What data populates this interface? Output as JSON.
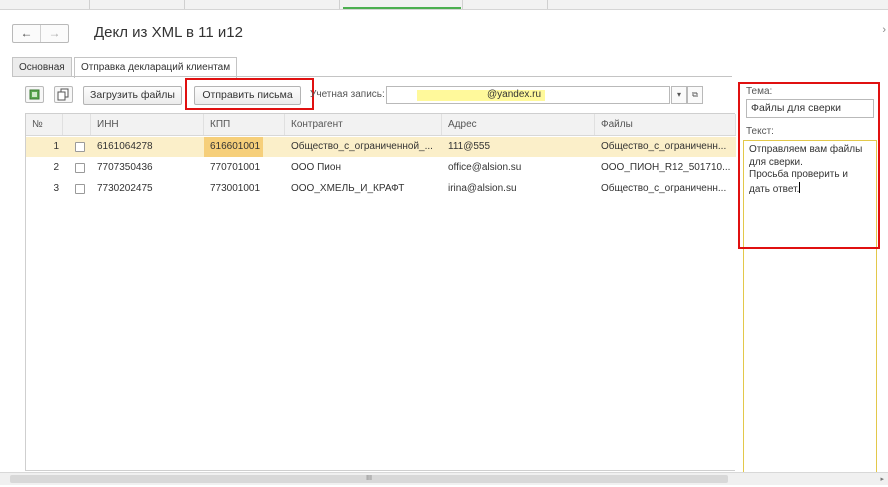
{
  "window": {
    "title": "Декл из XML в 11 и12",
    "close_icon": "close-icon"
  },
  "nav": {
    "back_icon": "←",
    "forward_icon": "→"
  },
  "tabs": [
    {
      "label": "Основная",
      "active": false
    },
    {
      "label": "Отправка деклараций клиентам",
      "active": true
    }
  ],
  "toolbar": {
    "load_files_label": "Загрузить файлы",
    "send_letters_label": "Отправить письма",
    "account_label": "Учетная запись:",
    "account_value": "@yandex.ru",
    "account_dropdown_glyph": "▾",
    "account_open_glyph": "⧉"
  },
  "table": {
    "columns": [
      "№",
      "",
      "ИНН",
      "КПП",
      "Контрагент",
      "Адрес",
      "Файлы"
    ],
    "rows": [
      {
        "num": "1",
        "checked": false,
        "inn": "6161064278",
        "kpp": "616601001",
        "contragent": "Общество_с_ограниченной_...",
        "address": "111@555",
        "files": "Общество_с_ограниченн..."
      },
      {
        "num": "2",
        "checked": false,
        "inn": "7707350436",
        "kpp": "770701001",
        "contragent": "ООО Пион",
        "address": "office@alsion.su",
        "files": "ООО_ПИОН_R12_501710..."
      },
      {
        "num": "3",
        "checked": false,
        "inn": "7730202475",
        "kpp": "773001001",
        "contragent": "ООО_ХМЕЛЬ_И_КРАФТ",
        "address": "irina@alsion.su",
        "files": "Общество_с_ограниченн..."
      }
    ]
  },
  "email_panel": {
    "subject_label": "Тема:",
    "subject_value": "Файлы для сверки",
    "body_label": "Текст:",
    "body_value": "Отправляем вам файлы\nдля сверки.\nПросьба проверить и\nдать ответ."
  },
  "scrollbar": {
    "thumb_glyph": "III",
    "right_arrow": "▸"
  },
  "colors": {
    "selected_row": "#fbefc9",
    "highlight_annotation": "#e01010",
    "account_highlight": "#fff99b"
  }
}
